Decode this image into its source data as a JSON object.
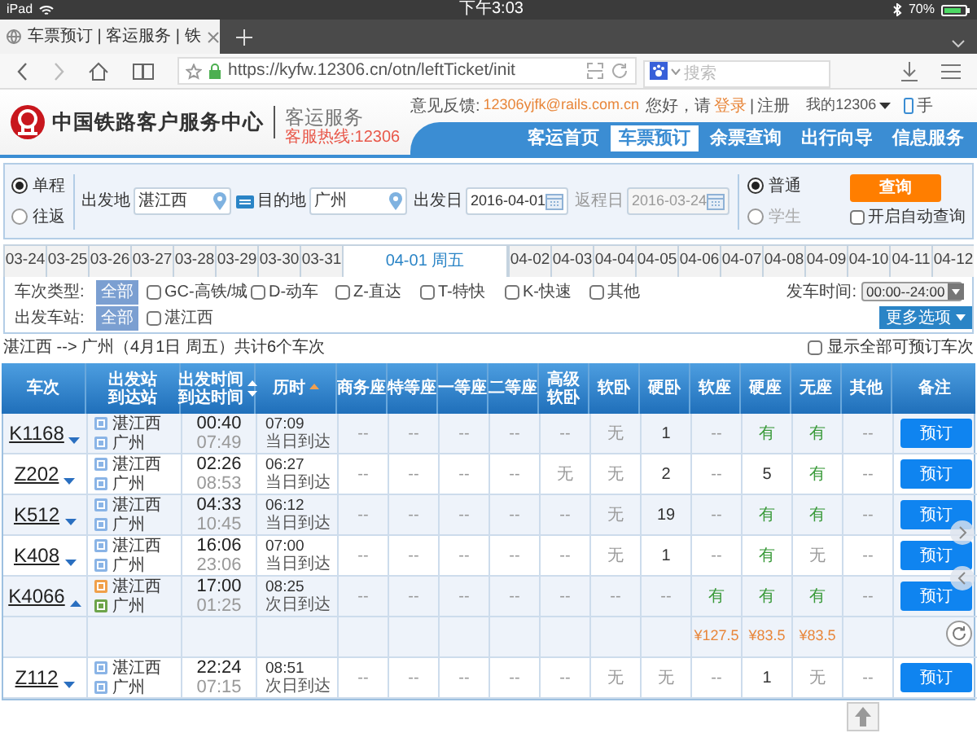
{
  "status_bar": {
    "device": "iPad",
    "time": "下午3:03",
    "battery": "70%"
  },
  "browser": {
    "tab_title": "车票预订 | 客运服务 | 铁",
    "url": "https://kyfw.12306.cn/otn/leftTicket/init",
    "search_placeholder": "搜索"
  },
  "site_header": {
    "title": "中国铁路客户服务中心",
    "subtitle": "客运服务",
    "hotline": "客服热线:12306",
    "feedback_label": "意见反馈:",
    "feedback_email": "12306yjfk@rails.com.cn",
    "greeting": "您好，请",
    "login": "登录",
    "separator": "|",
    "register": "注册",
    "account": "我的12306",
    "mobile": "手"
  },
  "nav": [
    {
      "label": "客运首页",
      "selected": false
    },
    {
      "label": "车票预订",
      "selected": true
    },
    {
      "label": "余票查询",
      "selected": false
    },
    {
      "label": "出行向导",
      "selected": false
    },
    {
      "label": "信息服务",
      "selected": false
    }
  ],
  "search_form": {
    "trip_types": [
      {
        "label": "单程",
        "selected": true
      },
      {
        "label": "往返",
        "selected": false
      }
    ],
    "from": {
      "label": "出发地",
      "value": "湛江西"
    },
    "to": {
      "label": "目的地",
      "value": "广州"
    },
    "depart_date": {
      "label": "出发日",
      "value": "2016-04-01",
      "disabled": false
    },
    "return_date": {
      "label": "返程日",
      "value": "2016-03-24",
      "disabled": true
    },
    "passenger_types": [
      {
        "label": "普通",
        "selected": true,
        "disabled": false
      },
      {
        "label": "学生",
        "selected": false,
        "disabled": true
      }
    ],
    "query_button": "查询",
    "auto_query": {
      "label": "开启自动查询",
      "checked": false
    }
  },
  "date_tabs": [
    {
      "label": "03-24",
      "selected": false
    },
    {
      "label": "03-25",
      "selected": false
    },
    {
      "label": "03-26",
      "selected": false
    },
    {
      "label": "03-27",
      "selected": false
    },
    {
      "label": "03-28",
      "selected": false
    },
    {
      "label": "03-29",
      "selected": false
    },
    {
      "label": "03-30",
      "selected": false
    },
    {
      "label": "03-31",
      "selected": false
    },
    {
      "label": "04-01 周五",
      "selected": true
    },
    {
      "label": "04-02",
      "selected": false
    },
    {
      "label": "04-03",
      "selected": false
    },
    {
      "label": "04-04",
      "selected": false
    },
    {
      "label": "04-05",
      "selected": false
    },
    {
      "label": "04-06",
      "selected": false
    },
    {
      "label": "04-07",
      "selected": false
    },
    {
      "label": "04-08",
      "selected": false
    },
    {
      "label": "04-09",
      "selected": false
    },
    {
      "label": "04-10",
      "selected": false
    },
    {
      "label": "04-11",
      "selected": false
    },
    {
      "label": "04-12",
      "selected": false
    }
  ],
  "filters": {
    "type_label": "车次类型:",
    "type_all": "全部",
    "train_types": [
      {
        "label": "GC-高铁/城",
        "checked": false
      },
      {
        "label": "D-动车",
        "checked": false
      },
      {
        "label": "Z-直达",
        "checked": false
      },
      {
        "label": "T-特快",
        "checked": false
      },
      {
        "label": "K-快速",
        "checked": false
      },
      {
        "label": "其他",
        "checked": false
      }
    ],
    "station_label": "出发车站:",
    "station_all": "全部",
    "stations": [
      {
        "label": "湛江西",
        "checked": false
      }
    ],
    "time_label": "发车时间:",
    "time_value": "00:00--24:00",
    "more_options": "更多选项"
  },
  "summary": "湛江西 --> 广州（4月1日 周五）共计6个车次",
  "show_all": {
    "label": "显示全部可预订车次",
    "checked": false
  },
  "table": {
    "columns": [
      {
        "lines": [
          "车次"
        ]
      },
      {
        "lines": [
          "出发站",
          "到达站"
        ]
      },
      {
        "lines": [
          "出发时间",
          "到达时间"
        ],
        "sortable": true,
        "sort_active": false
      },
      {
        "lines": [
          "历时"
        ],
        "sortable": true,
        "sort_active": true
      },
      {
        "lines": [
          "商务座"
        ]
      },
      {
        "lines": [
          "特等座"
        ]
      },
      {
        "lines": [
          "一等座"
        ]
      },
      {
        "lines": [
          "二等座"
        ]
      },
      {
        "lines": [
          "高级",
          "软卧"
        ]
      },
      {
        "lines": [
          "软卧"
        ]
      },
      {
        "lines": [
          "硬卧"
        ]
      },
      {
        "lines": [
          "软座"
        ]
      },
      {
        "lines": [
          "硬座"
        ]
      },
      {
        "lines": [
          "无座"
        ]
      },
      {
        "lines": [
          "其他"
        ]
      },
      {
        "lines": [
          "备注"
        ]
      }
    ],
    "rows": [
      {
        "train": "K1168",
        "expanded": false,
        "stations": [
          {
            "name": "湛江西",
            "color": "#8ab4e6"
          },
          {
            "name": "广州",
            "color": "#8ab4e6"
          }
        ],
        "depart": "00:40",
        "arrive": "07:49",
        "duration": "07:09",
        "arrival_day": "当日到达",
        "book_label": "预订",
        "seats": [
          {
            "text": "--",
            "kind": "na"
          },
          {
            "text": "--",
            "kind": "na"
          },
          {
            "text": "--",
            "kind": "na"
          },
          {
            "text": "--",
            "kind": "na"
          },
          {
            "text": "--",
            "kind": "na"
          },
          {
            "text": "无",
            "kind": "none"
          },
          {
            "text": "1",
            "kind": "count"
          },
          {
            "text": "--",
            "kind": "na"
          },
          {
            "text": "有",
            "kind": "yes"
          },
          {
            "text": "有",
            "kind": "yes"
          },
          {
            "text": "--",
            "kind": "na"
          }
        ]
      },
      {
        "train": "Z202",
        "expanded": false,
        "stations": [
          {
            "name": "湛江西",
            "color": "#8ab4e6"
          },
          {
            "name": "广州",
            "color": "#8ab4e6"
          }
        ],
        "depart": "02:26",
        "arrive": "08:53",
        "duration": "06:27",
        "arrival_day": "当日到达",
        "book_label": "预订",
        "seats": [
          {
            "text": "--",
            "kind": "na"
          },
          {
            "text": "--",
            "kind": "na"
          },
          {
            "text": "--",
            "kind": "na"
          },
          {
            "text": "--",
            "kind": "na"
          },
          {
            "text": "无",
            "kind": "none"
          },
          {
            "text": "无",
            "kind": "none"
          },
          {
            "text": "2",
            "kind": "count"
          },
          {
            "text": "--",
            "kind": "na"
          },
          {
            "text": "5",
            "kind": "count"
          },
          {
            "text": "有",
            "kind": "yes"
          },
          {
            "text": "--",
            "kind": "na"
          }
        ]
      },
      {
        "train": "K512",
        "expanded": false,
        "stations": [
          {
            "name": "湛江西",
            "color": "#8ab4e6"
          },
          {
            "name": "广州",
            "color": "#8ab4e6"
          }
        ],
        "depart": "04:33",
        "arrive": "10:45",
        "duration": "06:12",
        "arrival_day": "当日到达",
        "book_label": "预订",
        "seats": [
          {
            "text": "--",
            "kind": "na"
          },
          {
            "text": "--",
            "kind": "na"
          },
          {
            "text": "--",
            "kind": "na"
          },
          {
            "text": "--",
            "kind": "na"
          },
          {
            "text": "--",
            "kind": "na"
          },
          {
            "text": "无",
            "kind": "none"
          },
          {
            "text": "19",
            "kind": "count"
          },
          {
            "text": "--",
            "kind": "na"
          },
          {
            "text": "有",
            "kind": "yes"
          },
          {
            "text": "有",
            "kind": "yes"
          },
          {
            "text": "--",
            "kind": "na"
          }
        ]
      },
      {
        "train": "K408",
        "expanded": false,
        "stations": [
          {
            "name": "湛江西",
            "color": "#8ab4e6"
          },
          {
            "name": "广州",
            "color": "#8ab4e6"
          }
        ],
        "depart": "16:06",
        "arrive": "23:06",
        "duration": "07:00",
        "arrival_day": "当日到达",
        "book_label": "预订",
        "seats": [
          {
            "text": "--",
            "kind": "na"
          },
          {
            "text": "--",
            "kind": "na"
          },
          {
            "text": "--",
            "kind": "na"
          },
          {
            "text": "--",
            "kind": "na"
          },
          {
            "text": "--",
            "kind": "na"
          },
          {
            "text": "无",
            "kind": "none"
          },
          {
            "text": "1",
            "kind": "count"
          },
          {
            "text": "--",
            "kind": "na"
          },
          {
            "text": "有",
            "kind": "yes"
          },
          {
            "text": "无",
            "kind": "none"
          },
          {
            "text": "--",
            "kind": "na"
          }
        ]
      },
      {
        "train": "K4066",
        "expanded": true,
        "stations": [
          {
            "name": "湛江西",
            "color": "#f0a04a"
          },
          {
            "name": "广州",
            "color": "#6da44a"
          }
        ],
        "depart": "17:00",
        "arrive": "01:25",
        "duration": "08:25",
        "arrival_day": "次日到达",
        "book_label": "预订",
        "seats": [
          {
            "text": "--",
            "kind": "na"
          },
          {
            "text": "--",
            "kind": "na"
          },
          {
            "text": "--",
            "kind": "na"
          },
          {
            "text": "--",
            "kind": "na"
          },
          {
            "text": "--",
            "kind": "na"
          },
          {
            "text": "--",
            "kind": "na"
          },
          {
            "text": "--",
            "kind": "na"
          },
          {
            "text": "有",
            "kind": "yes",
            "price": "¥127.5"
          },
          {
            "text": "有",
            "kind": "yes",
            "price": "¥83.5"
          },
          {
            "text": "有",
            "kind": "yes",
            "price": "¥83.5"
          },
          {
            "text": "--",
            "kind": "na"
          }
        ]
      },
      {
        "train": "Z112",
        "expanded": false,
        "stations": [
          {
            "name": "湛江西",
            "color": "#8ab4e6"
          },
          {
            "name": "广州",
            "color": "#8ab4e6"
          }
        ],
        "depart": "22:24",
        "arrive": "07:15",
        "duration": "08:51",
        "arrival_day": "次日到达",
        "book_label": "预订",
        "seats": [
          {
            "text": "--",
            "kind": "na"
          },
          {
            "text": "--",
            "kind": "na"
          },
          {
            "text": "--",
            "kind": "na"
          },
          {
            "text": "--",
            "kind": "na"
          },
          {
            "text": "--",
            "kind": "na"
          },
          {
            "text": "无",
            "kind": "none"
          },
          {
            "text": "无",
            "kind": "none"
          },
          {
            "text": "--",
            "kind": "na"
          },
          {
            "text": "1",
            "kind": "count"
          },
          {
            "text": "无",
            "kind": "none"
          },
          {
            "text": "--",
            "kind": "na"
          }
        ]
      }
    ]
  }
}
